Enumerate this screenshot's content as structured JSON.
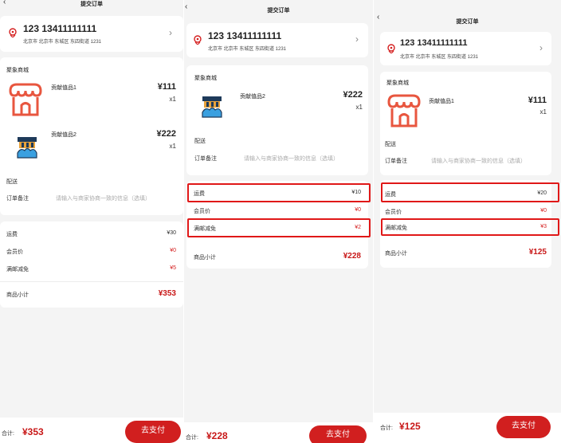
{
  "screens": [
    {
      "title": "提交订单",
      "back_icon": "chevron-left-icon",
      "address": {
        "name_phone": "123 13411111111",
        "detail": "北京市 北京市 东城区 东四街道 1231"
      },
      "shop_name": "聚象商城",
      "items": [
        {
          "name": "贡献值品1",
          "price": "¥111",
          "qty": "x1",
          "icon": "store-icon"
        },
        {
          "name": "贡献值品2",
          "price": "¥222",
          "qty": "x1",
          "icon": "building-icon"
        }
      ],
      "delivery_label": "配送",
      "remark_label": "订单备注",
      "remark_placeholder": "请输入与商家协商一致的信息（选填）",
      "shipping_label": "运费",
      "shipping_value": "¥30",
      "member_label": "会员价",
      "member_value": "¥0",
      "discount_label": "满邮减免",
      "discount_value": "¥5",
      "subtotal_label": "商品小计",
      "subtotal_value": "¥353",
      "total_label": "合计:",
      "total_value": "¥353",
      "pay_label": "去支付"
    },
    {
      "title": "提交订单",
      "back_icon": "chevron-left-icon",
      "address": {
        "name_phone": "123 13411111111",
        "detail": "北京市 北京市 东城区 东四街道 1231"
      },
      "shop_name": "聚象商城",
      "items": [
        {
          "name": "贡献值品2",
          "price": "¥222",
          "qty": "x1",
          "icon": "building-icon"
        }
      ],
      "delivery_label": "配送",
      "remark_label": "订单备注",
      "remark_placeholder": "请输入与商家协商一致的信息（选填）",
      "shipping_label": "运费",
      "shipping_value": "¥10",
      "member_label": "会员价",
      "member_value": "¥0",
      "discount_label": "满邮减免",
      "discount_value": "¥2",
      "subtotal_label": "商品小计",
      "subtotal_value": "¥228",
      "total_label": "合计:",
      "total_value": "¥228",
      "pay_label": "去支付"
    },
    {
      "title": "提交订单",
      "back_icon": "chevron-left-icon",
      "address": {
        "name_phone": "123 13411111111",
        "detail": "北京市 北京市 东城区 东四街道 1231"
      },
      "shop_name": "聚象商城",
      "items": [
        {
          "name": "贡献值品1",
          "price": "¥111",
          "qty": "x1",
          "icon": "store-icon"
        }
      ],
      "delivery_label": "配送",
      "remark_label": "订单备注",
      "remark_placeholder": "请输入与商家协商一致的信息（选填）",
      "shipping_label": "运费",
      "shipping_value": "¥20",
      "member_label": "会员价",
      "member_value": "¥0",
      "discount_label": "满邮减免",
      "discount_value": "¥3",
      "subtotal_label": "商品小计",
      "subtotal_value": "¥125",
      "total_label": "合计:",
      "total_value": "¥125",
      "pay_label": "去支付"
    }
  ],
  "colors": {
    "accent": "#d11f1f",
    "highlight": "#e01818",
    "background": "#f4f4f4"
  }
}
